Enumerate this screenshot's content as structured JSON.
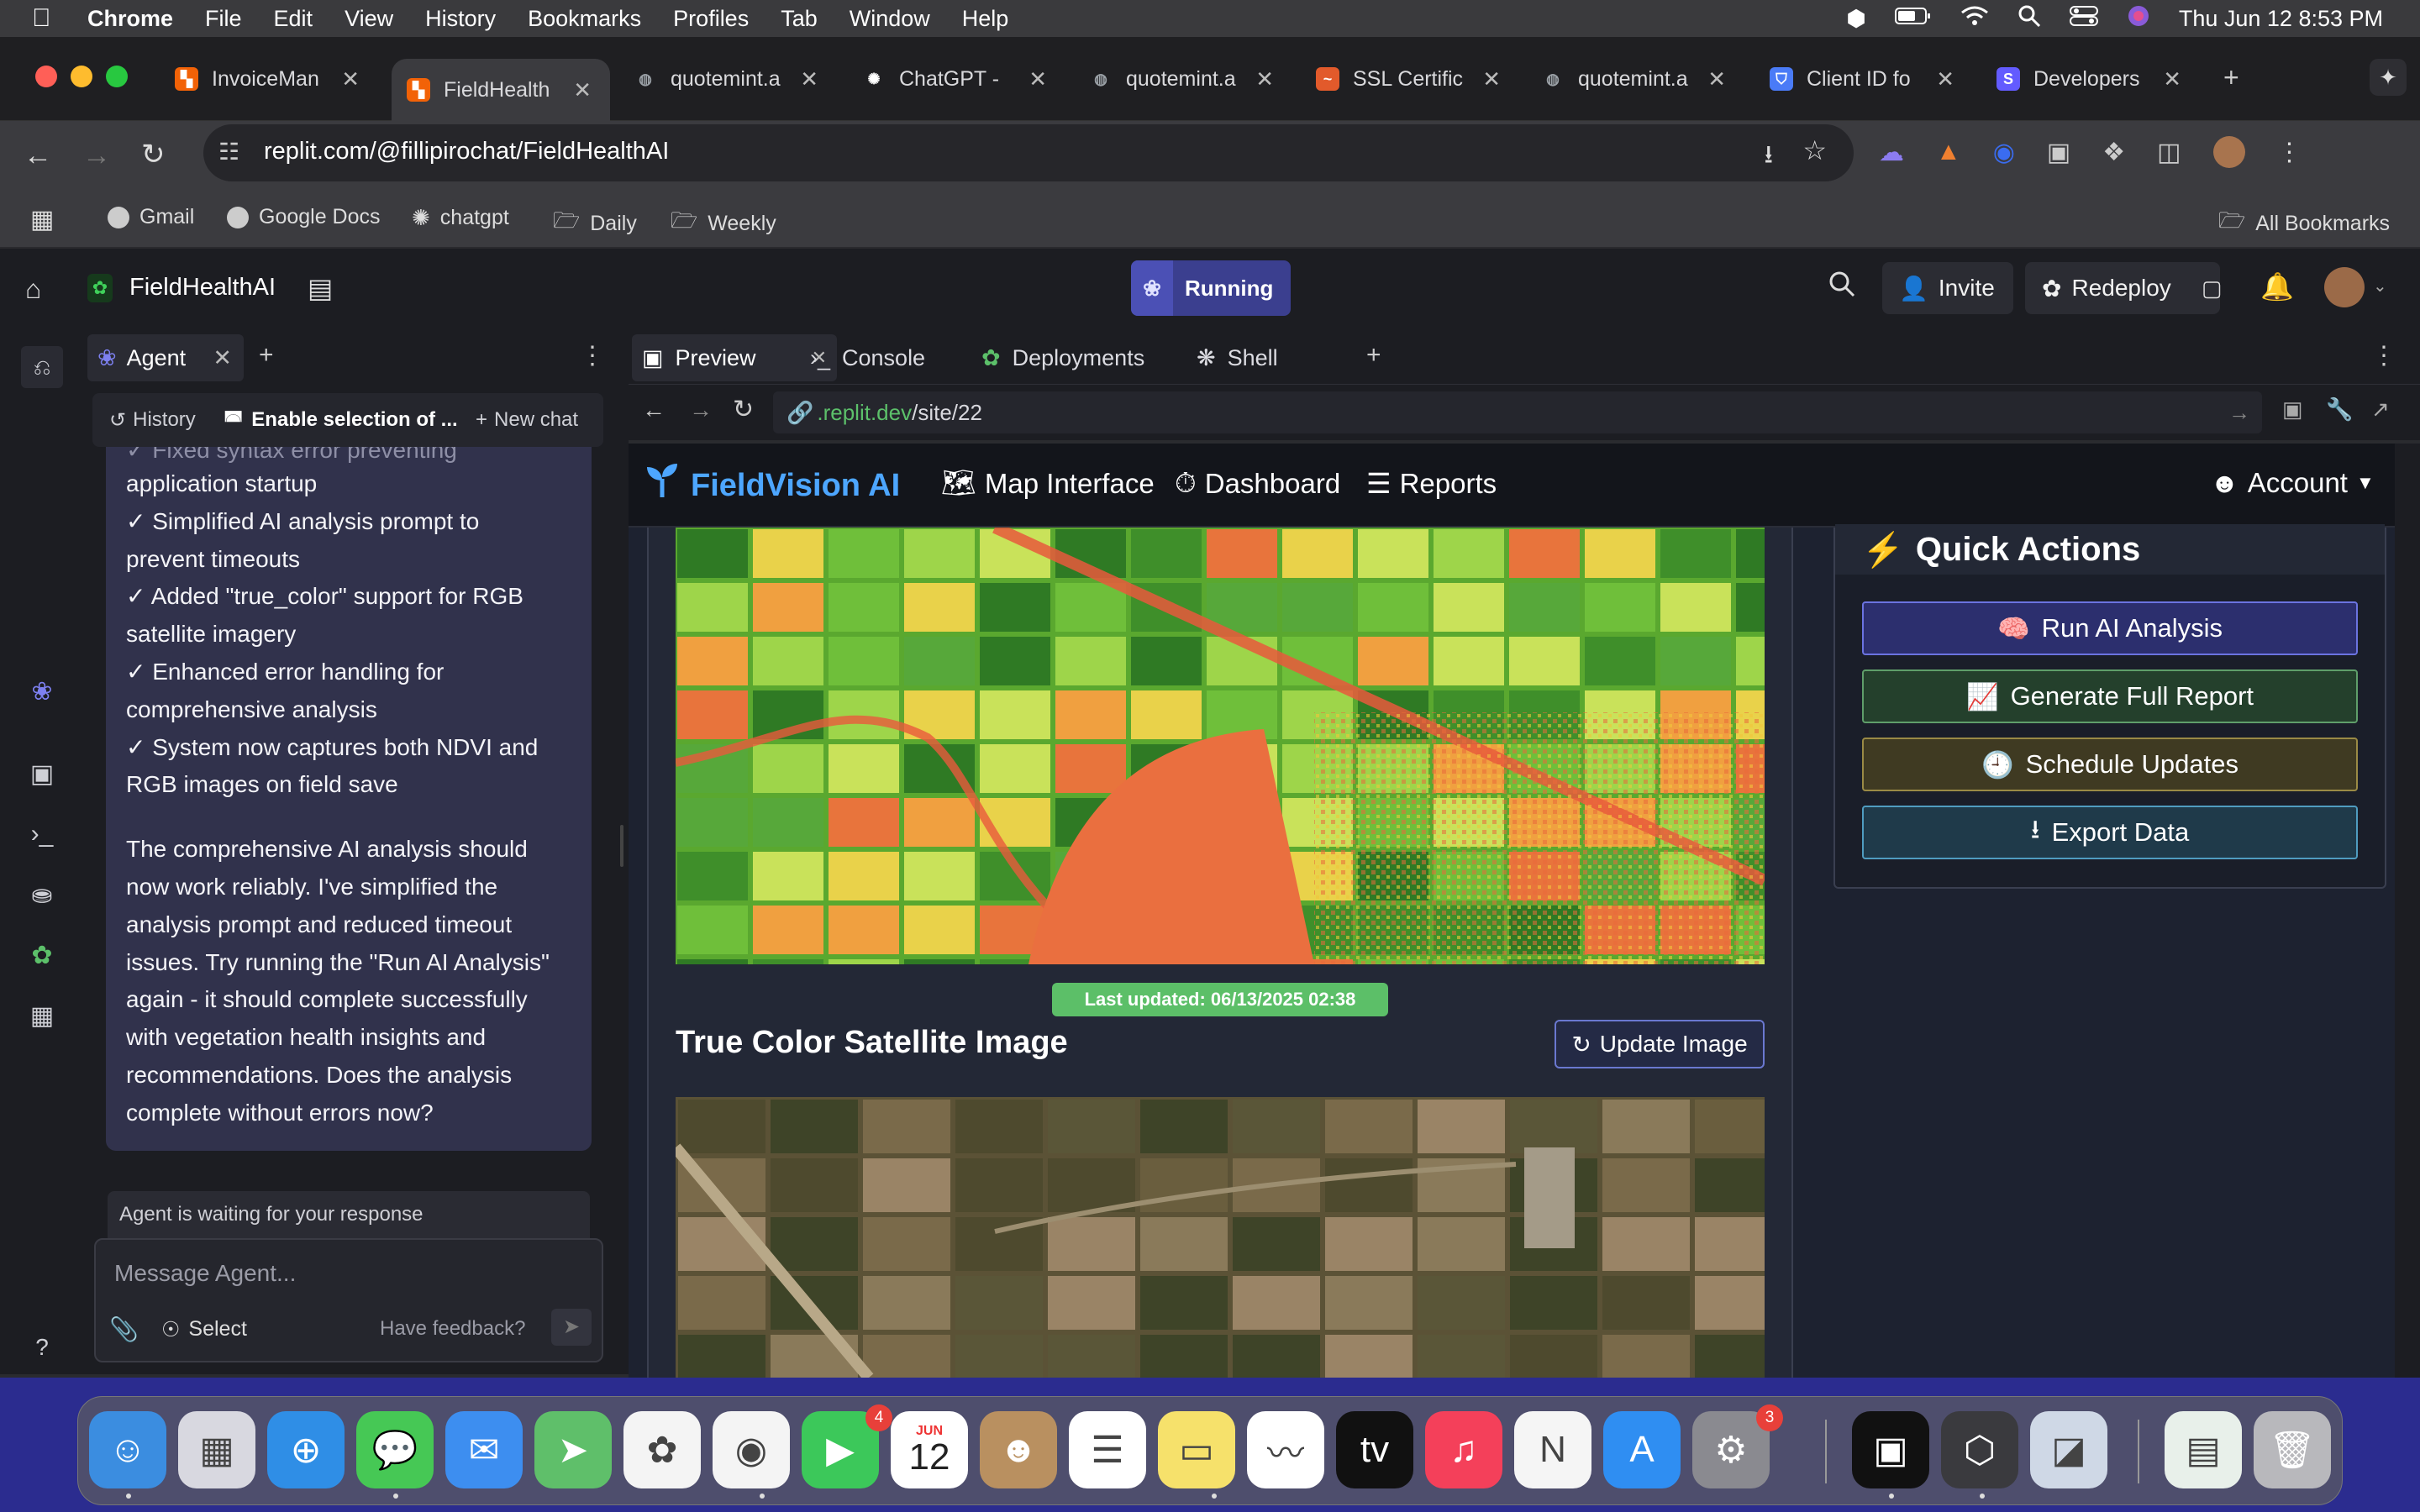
{
  "menubar": {
    "app": "Chrome",
    "items": [
      "File",
      "Edit",
      "View",
      "History",
      "Bookmarks",
      "Profiles",
      "Tab",
      "Window",
      "Help"
    ],
    "datetime": "Thu Jun 12  8:53 PM"
  },
  "browser": {
    "tabs": [
      {
        "title": "InvoiceMan",
        "icon": "replit-icon",
        "color": "#f26207"
      },
      {
        "title": "FieldHealth",
        "icon": "replit-icon",
        "color": "#f26207"
      },
      {
        "title": "quotemint.a",
        "icon": "globe-icon",
        "color": "#9aa0a6"
      },
      {
        "title": "ChatGPT -",
        "icon": "chatgpt-icon",
        "color": "#ffffff"
      },
      {
        "title": "quotemint.a",
        "icon": "globe-icon",
        "color": "#9aa0a6"
      },
      {
        "title": "SSL Certific",
        "icon": "ssl-icon",
        "color": "#e25a2b"
      },
      {
        "title": "quotemint.a",
        "icon": "globe-icon",
        "color": "#9aa0a6"
      },
      {
        "title": "Client ID fo",
        "icon": "shield-icon",
        "color": "#4a7bf7"
      },
      {
        "title": "Developers",
        "icon": "stripe-icon",
        "color": "#635bff"
      }
    ],
    "url": "replit.com/@fillipirochat/FieldHealthAI",
    "bookmarks": [
      "Gmail",
      "Google Docs",
      "chatgpt",
      "Daily",
      "Weekly"
    ],
    "all_bookmarks": "All Bookmarks"
  },
  "replit": {
    "project": "FieldHealthAI",
    "status": "Running",
    "invite": "Invite",
    "redeploy": "Redeploy",
    "agent_tab": "Agent",
    "history": "History",
    "enable_selection": "Enable selection of ...",
    "new_chat": "New chat",
    "message_lines_faded": "✓ Fixed syntax error preventing",
    "message_lines": [
      "application startup",
      "✓ Simplified AI analysis prompt to",
      "prevent timeouts",
      "✓ Added \"true_color\" support for RGB",
      "satellite imagery",
      "✓ Enhanced error handling for",
      "comprehensive analysis",
      "✓ System now captures both NDVI and",
      "RGB images on field save"
    ],
    "message_paragraph": [
      "The comprehensive AI analysis should",
      "now work reliably. I've simplified the",
      "analysis prompt and reduced timeout",
      "issues. Try running the \"Run AI Analysis\"",
      "again - it should complete successfully",
      "with vegetation health insights and",
      "recommendations. Does the analysis",
      "complete without errors now?"
    ],
    "waiting": "Agent is waiting for your response",
    "message_placeholder": "Message Agent...",
    "select": "Select",
    "feedback": "Have feedback?",
    "preview_tabs": [
      "Preview",
      "Console",
      "Deployments",
      "Shell"
    ],
    "preview_url_domain": ".replit.dev",
    "preview_url_path": "/site/22"
  },
  "site": {
    "brand": "FieldVision AI",
    "nav": [
      "Map Interface",
      "Dashboard",
      "Reports"
    ],
    "account": "Account",
    "last_updated": "Last updated: 06/13/2025 02:38",
    "true_color_title": "True Color Satellite Image",
    "update_image": "Update Image",
    "quick_actions_title": "Quick Actions",
    "actions": [
      {
        "label": "Run AI Analysis",
        "icon": "brain-icon",
        "bg": "#2c2f6e",
        "border": "#6b73e0"
      },
      {
        "label": "Generate Full Report",
        "icon": "chart-line-icon",
        "bg": "#24402c",
        "border": "#5f9e6a"
      },
      {
        "label": "Schedule Updates",
        "icon": "clock-icon",
        "bg": "#3f3a22",
        "border": "#9a8a45"
      },
      {
        "label": "Export Data",
        "icon": "download-icon",
        "bg": "#1f3a4a",
        "border": "#4f9cc0"
      }
    ]
  },
  "dock": {
    "apps": [
      {
        "name": "Finder",
        "color": "#3b8de0"
      },
      {
        "name": "Launchpad",
        "color": "#d8d8e0"
      },
      {
        "name": "Safari",
        "color": "#2f8ee6"
      },
      {
        "name": "Messages",
        "color": "#46c855"
      },
      {
        "name": "Mail",
        "color": "#3d8ef0"
      },
      {
        "name": "Maps",
        "color": "#5fbf6a"
      },
      {
        "name": "Photos",
        "color": "#f4f4f4"
      },
      {
        "name": "Chrome",
        "color": "#f4f4f4"
      },
      {
        "name": "FaceTime",
        "color": "#3cc85a"
      },
      {
        "name": "Calendar",
        "color": "#ffffff"
      },
      {
        "name": "Contacts",
        "color": "#b99060"
      },
      {
        "name": "Reminders",
        "color": "#ffffff"
      },
      {
        "name": "Notes",
        "color": "#f6e16b"
      },
      {
        "name": "Freeform",
        "color": "#ffffff"
      },
      {
        "name": "TV",
        "color": "#111111"
      },
      {
        "name": "Music",
        "color": "#f4405a"
      },
      {
        "name": "News",
        "color": "#f5f5f5"
      },
      {
        "name": "App Store",
        "color": "#2f8ef2"
      },
      {
        "name": "System Settings",
        "color": "#8a8a90"
      },
      {
        "name": "Cursor",
        "color": "#111111"
      },
      {
        "name": "Unity Hub",
        "color": "#3a3a3e"
      },
      {
        "name": "Preview",
        "color": "#cfd8e6"
      },
      {
        "name": "Downloads",
        "color": "#e8f0ea"
      },
      {
        "name": "Trash",
        "color": "#b8b8bc"
      }
    ],
    "calendar_month": "JUN",
    "calendar_day": "12",
    "facetime_badge": "4",
    "settings_badge": "3"
  }
}
